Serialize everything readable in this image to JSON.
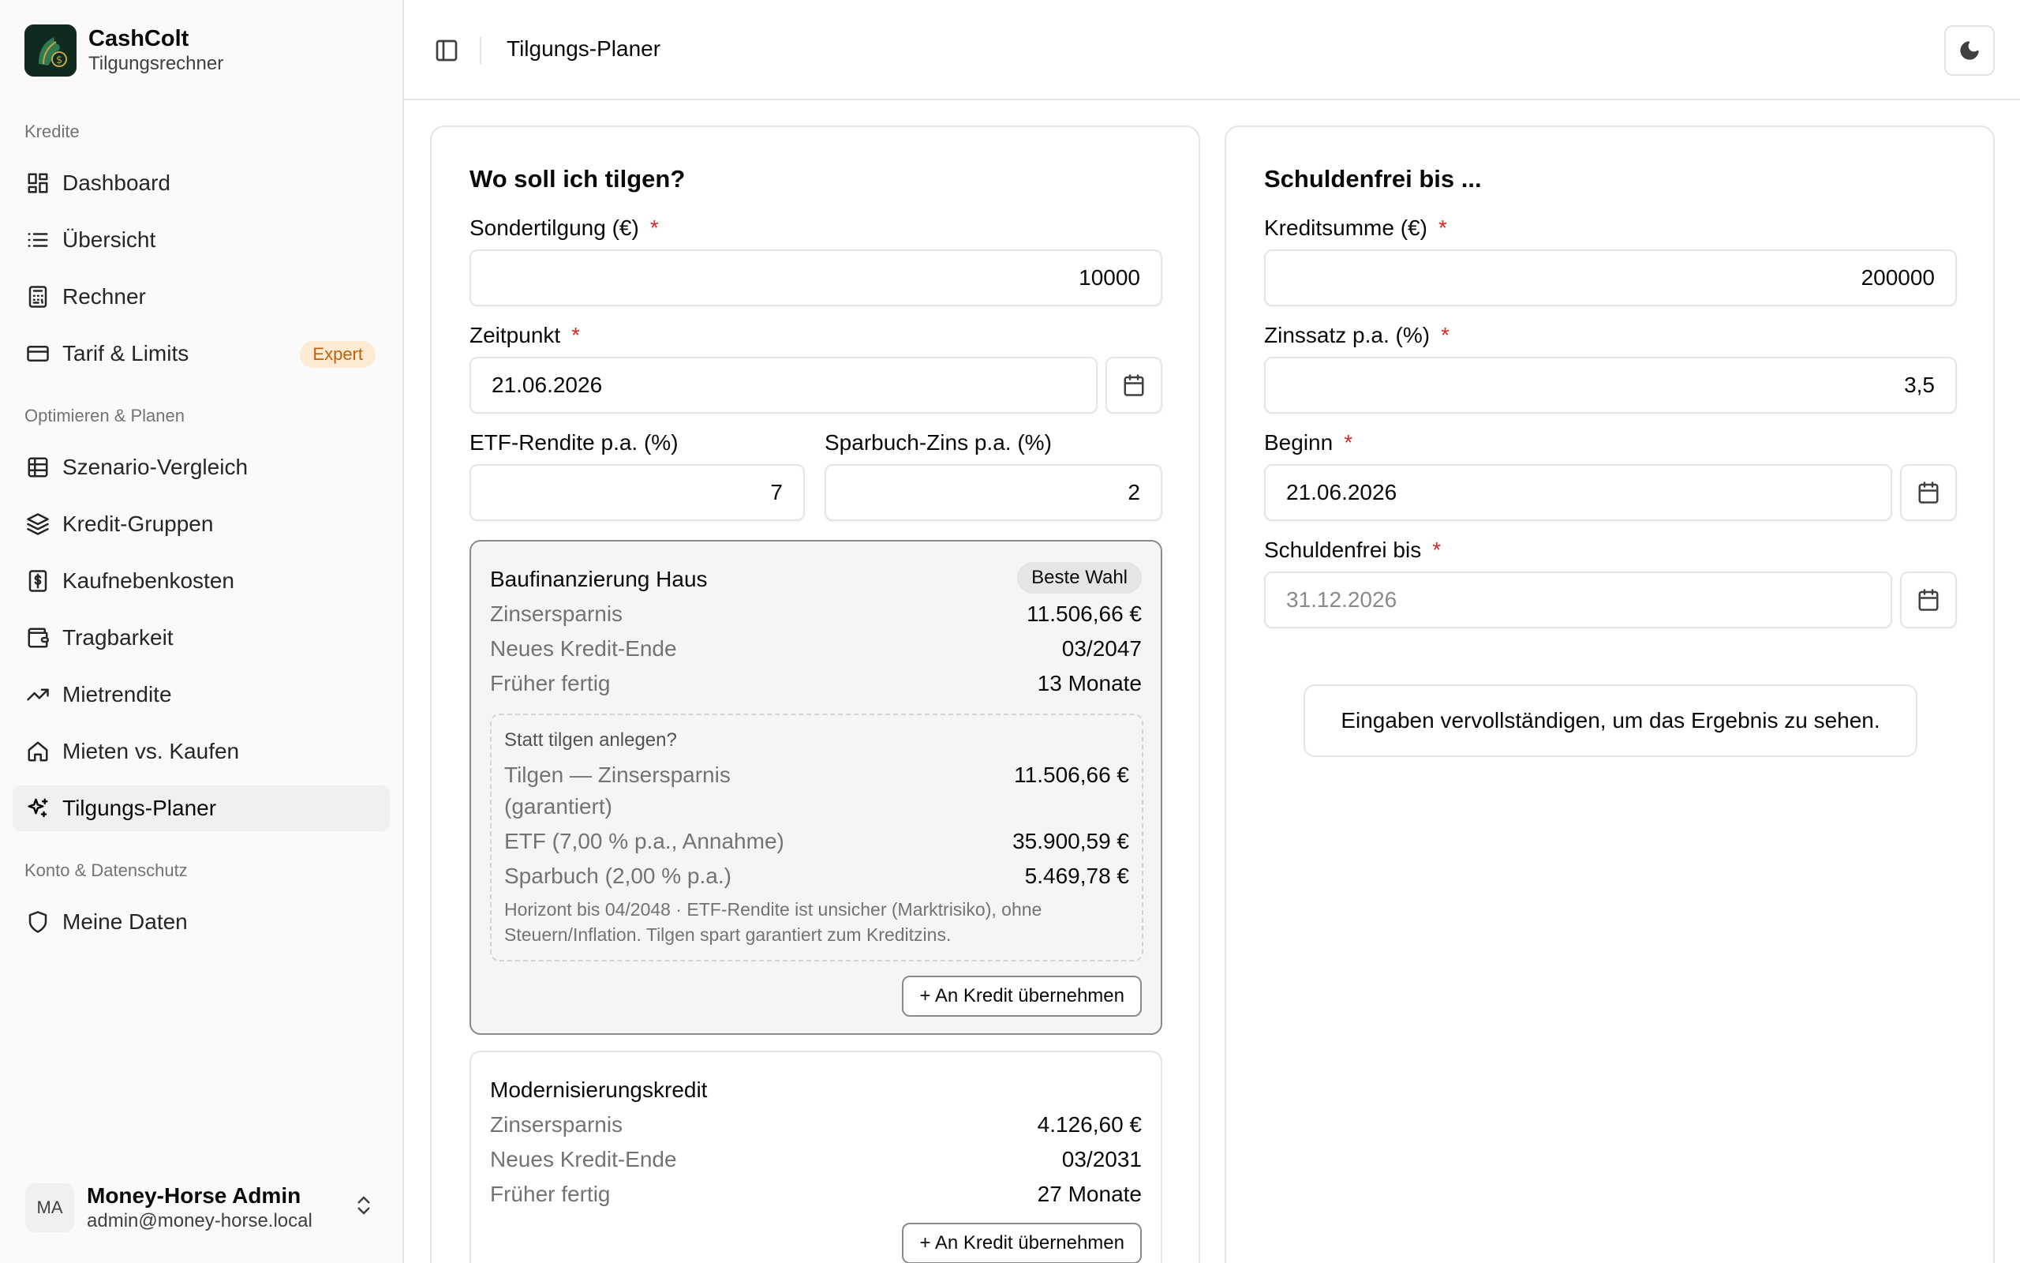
{
  "brand": {
    "name": "CashColt",
    "subtitle": "Tilgungsrechner"
  },
  "nav": {
    "section_kredite": "Kredite",
    "dashboard": "Dashboard",
    "uebersicht": "Übersicht",
    "rechner": "Rechner",
    "tarif": "Tarif & Limits",
    "tarif_badge": "Expert",
    "section_optimieren": "Optimieren & Planen",
    "szenario": "Szenario-Vergleich",
    "kreditgruppen": "Kredit-Gruppen",
    "kaufnebenkosten": "Kaufnebenkosten",
    "tragbarkeit": "Tragbarkeit",
    "mietrendite": "Mietrendite",
    "mieten_kaufen": "Mieten vs. Kaufen",
    "tilgungsplaner": "Tilgungs-Planer",
    "section_konto": "Konto & Datenschutz",
    "meine_daten": "Meine Daten"
  },
  "user": {
    "initials": "MA",
    "name": "Money-Horse Admin",
    "email": "admin@money-horse.local"
  },
  "header": {
    "title": "Tilgungs-Planer"
  },
  "left_card": {
    "title": "Wo soll ich tilgen?",
    "sondertilgung_label": "Sondertilgung (€)",
    "sondertilgung_value": "10000",
    "zeitpunkt_label": "Zeitpunkt",
    "zeitpunkt_value": "21.06.2026",
    "etf_label": "ETF-Rendite p.a. (%)",
    "etf_value": "7",
    "sparbuch_label": "Sparbuch-Zins p.a. (%)",
    "sparbuch_value": "2",
    "required_mark": "*",
    "loans": [
      {
        "name": "Baufinanzierung Haus",
        "badge": "Beste Wahl",
        "zinsersparnis_label": "Zinsersparnis",
        "zinsersparnis": "11.506,66 €",
        "ende_label": "Neues Kredit-Ende",
        "ende": "03/2047",
        "frueher_label": "Früher fertig",
        "frueher": "13 Monate",
        "alt_title": "Statt tilgen anlegen?",
        "alt_tilgen_label": "Tilgen — Zinsersparnis (garantiert)",
        "alt_tilgen": "11.506,66 €",
        "alt_etf_label": "ETF (7,00 % p.a., Annahme)",
        "alt_etf": "35.900,59 €",
        "alt_spar_label": "Sparbuch (2,00 % p.a.)",
        "alt_spar": "5.469,78 €",
        "alt_note": "Horizont bis 04/2048 · ETF-Rendite ist unsicher (Marktrisiko), ohne Steuern/Inflation. Tilgen spart garantiert zum Kreditzins.",
        "button": "+ An Kredit übernehmen"
      },
      {
        "name": "Modernisierungskredit",
        "zinsersparnis_label": "Zinsersparnis",
        "zinsersparnis": "4.126,60 €",
        "ende_label": "Neues Kredit-Ende",
        "ende": "03/2031",
        "frueher_label": "Früher fertig",
        "frueher": "27 Monate",
        "button": "+ An Kredit übernehmen"
      }
    ]
  },
  "right_card": {
    "title": "Schuldenfrei bis ...",
    "kreditsumme_label": "Kreditsumme (€)",
    "kreditsumme_value": "200000",
    "zinssatz_label": "Zinssatz p.a. (%)",
    "zinssatz_value": "3,5",
    "beginn_label": "Beginn",
    "beginn_value": "21.06.2026",
    "schuldenfrei_label": "Schuldenfrei bis",
    "schuldenfrei_placeholder": "31.12.2026",
    "hint": "Eingaben vervollständigen, um das Ergebnis zu sehen."
  },
  "colors": {
    "accent_required": "#dc2626",
    "badge_expert_bg": "#fdebd3",
    "badge_expert_fg": "#c2620c",
    "logo_bg": "#0f2a1f"
  }
}
